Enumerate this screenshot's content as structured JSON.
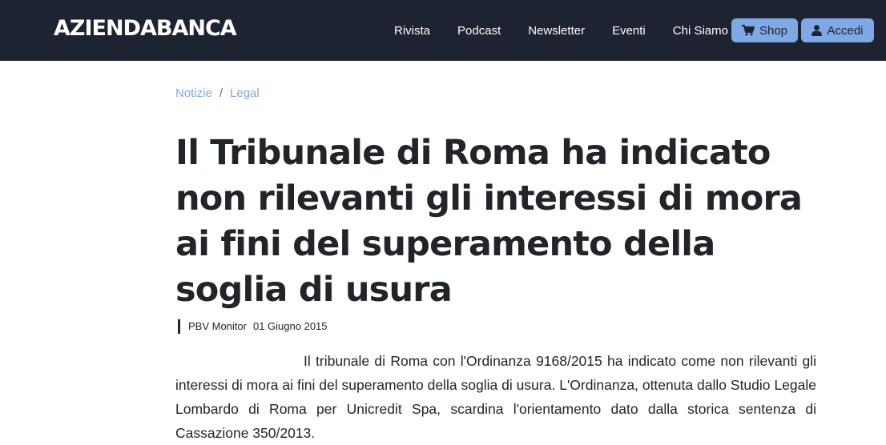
{
  "header": {
    "brand": "AZIENDABANCA",
    "nav": [
      "Rivista",
      "Podcast",
      "Newsletter",
      "Eventi",
      "Chi Siamo"
    ],
    "shop_label": "Shop",
    "login_label": "Accedi"
  },
  "breadcrumb": {
    "items": [
      "Notizie",
      "Legal"
    ],
    "separator": "/"
  },
  "article": {
    "title": "Il Tribunale di Roma ha indicato non rilevanti gli interessi di mora ai fini del superamento della soglia di usura",
    "source": "PBV Monitor",
    "date": "01 Giugno 2015",
    "body": "Il tribunale di Roma con l'Ordinanza 9168/2015 ha indicato come non rilevanti gli interessi di mora ai fini del superamento della soglia di usura. L'Ordinanza, ottenuta dallo Studio Legale Lombardo di Roma per Unicredit Spa, scardina l'orientamento dato dalla storica sentenza di Cassazione 350/2013."
  },
  "colors": {
    "navbar_bg": "#1d2330",
    "accent": "#7fa8e6",
    "text": "#212529"
  },
  "icons": {
    "shop": "shopping-cart-icon",
    "login": "user-icon"
  }
}
